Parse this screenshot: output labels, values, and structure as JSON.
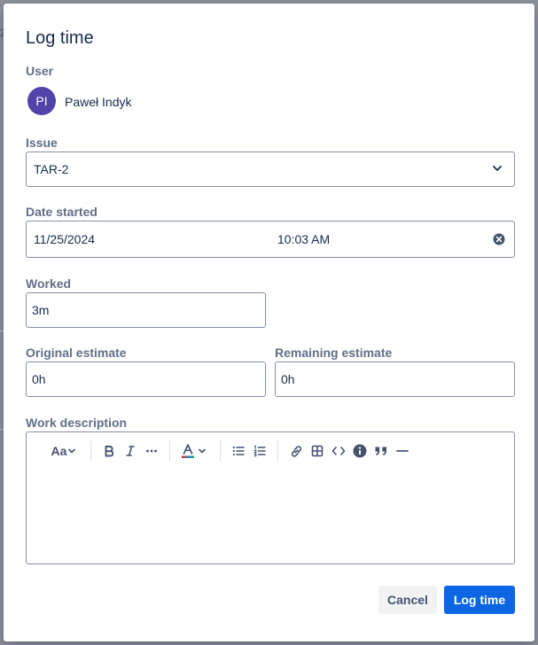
{
  "dialog": {
    "title": "Log time"
  },
  "user": {
    "label": "User",
    "initials": "PI",
    "name": "Paweł Indyk",
    "avatar_color": "#5243aa"
  },
  "issue": {
    "label": "Issue",
    "value": "TAR-2"
  },
  "date_started": {
    "label": "Date started",
    "date": "11/25/2024",
    "time": "10:03 AM"
  },
  "worked": {
    "label": "Worked",
    "value": "3m"
  },
  "original_estimate": {
    "label": "Original estimate",
    "value": "0h"
  },
  "remaining_estimate": {
    "label": "Remaining estimate",
    "value": "0h"
  },
  "work_description": {
    "label": "Work description",
    "toolbar": {
      "text_style": "Aa",
      "icons": [
        "text-style-icon",
        "bold-icon",
        "italic-icon",
        "more-icon",
        "text-color-icon",
        "bullet-list-icon",
        "numbered-list-icon",
        "link-icon",
        "table-icon",
        "code-icon",
        "info-icon",
        "quote-icon",
        "divider-icon"
      ]
    },
    "value": ""
  },
  "buttons": {
    "cancel": "Cancel",
    "submit": "Log time"
  },
  "colors": {
    "primary": "#0c66e4",
    "label": "#626f86",
    "text": "#172b4d",
    "border": "#8590a2"
  }
}
